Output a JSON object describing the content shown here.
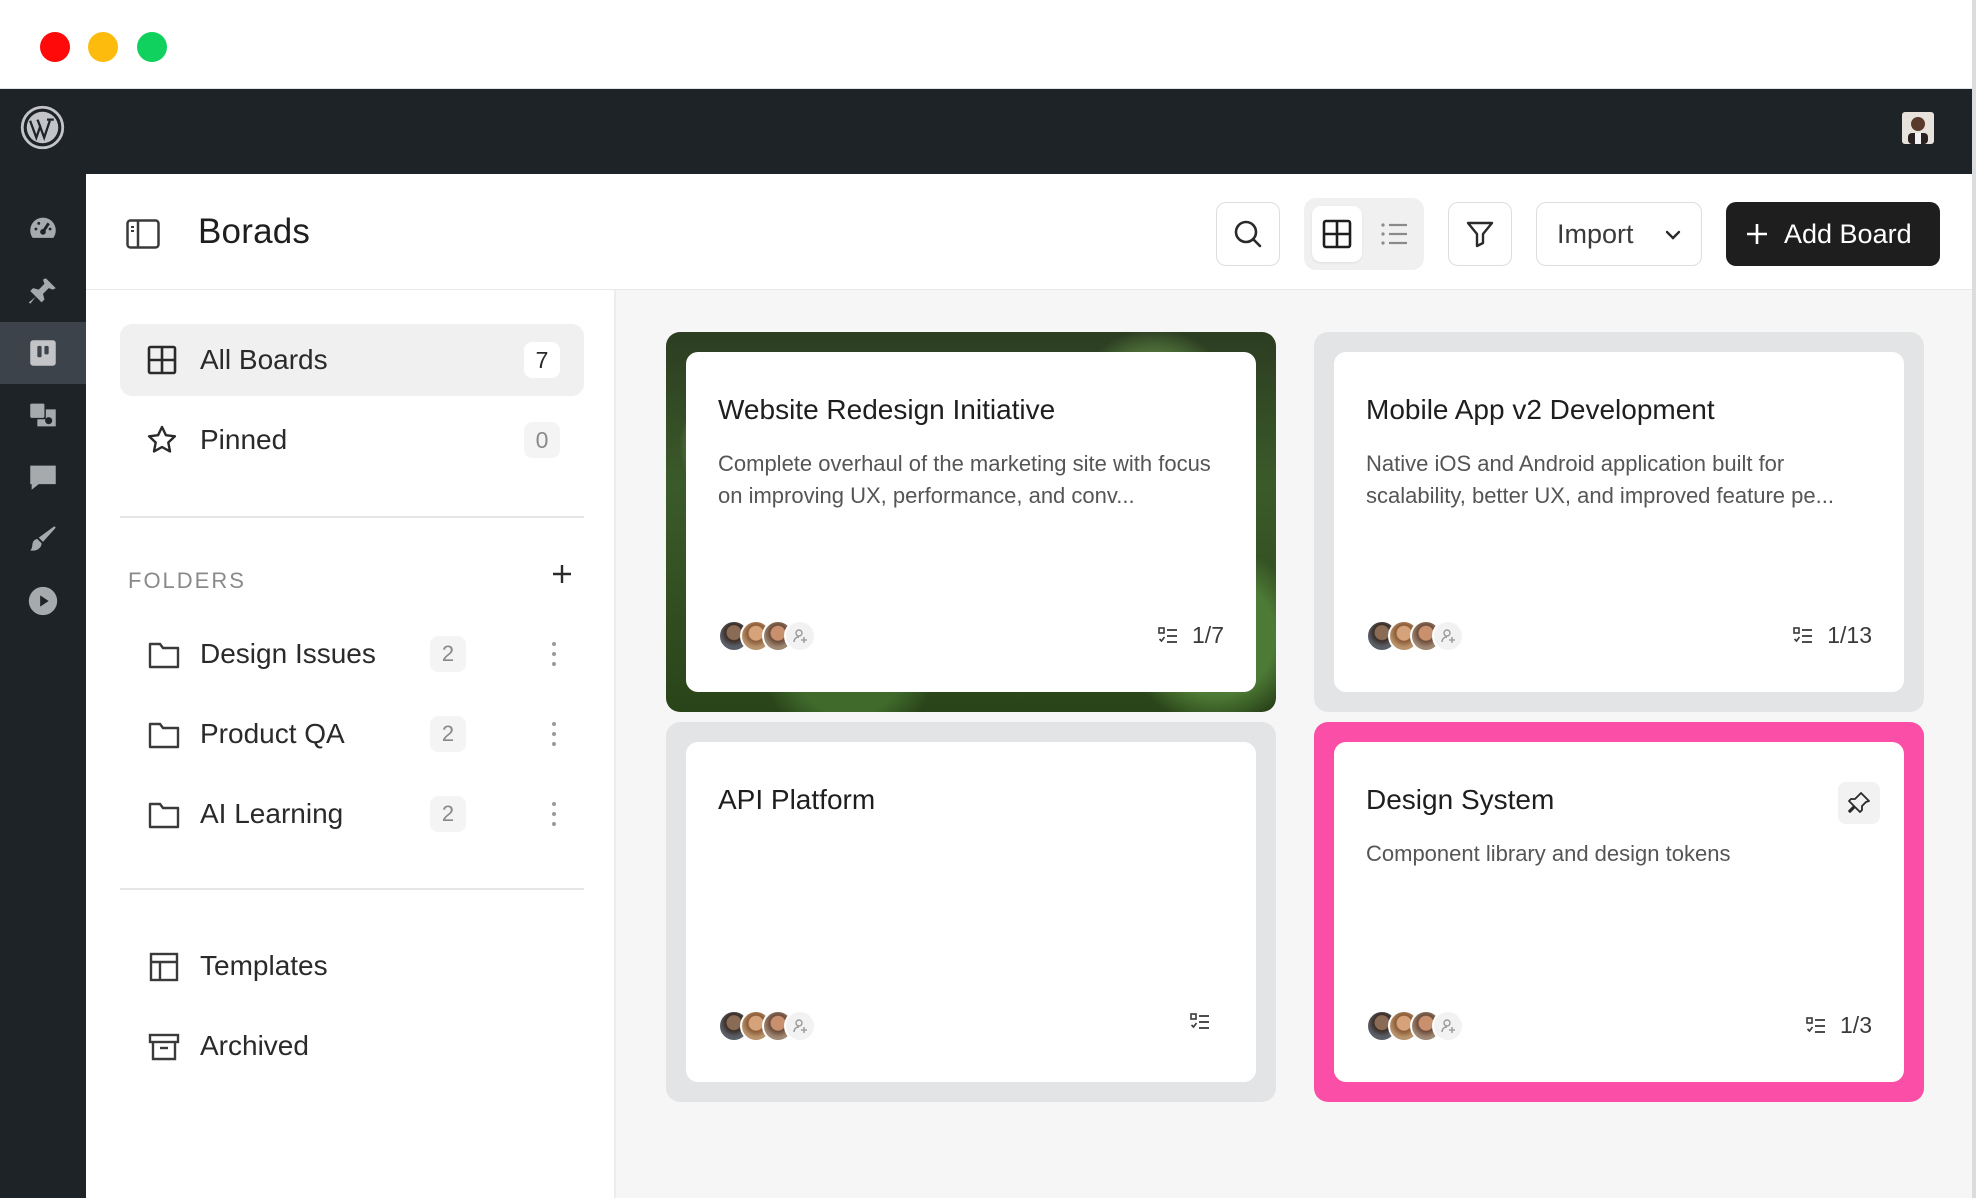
{
  "header": {
    "title": "Borads",
    "import_label": "Import",
    "add_board_label": "Add Board"
  },
  "sidebar": {
    "nav": [
      {
        "label": "All Boards",
        "count": "7",
        "icon": "grid-icon"
      },
      {
        "label": "Pinned",
        "count": "0",
        "icon": "star-icon"
      }
    ],
    "folders_heading": "FOLDERS",
    "folders": [
      {
        "label": "Design Issues",
        "count": "2"
      },
      {
        "label": "Product QA",
        "count": "2"
      },
      {
        "label": "AI Learning",
        "count": "2"
      }
    ],
    "bottom": [
      {
        "label": "Templates",
        "icon": "template-icon"
      },
      {
        "label": "Archived",
        "icon": "archive-icon"
      }
    ]
  },
  "boards": [
    {
      "title": "Website Redesign Initiative",
      "description": "Complete overhaul of the marketing site with focus on improving UX, performance, and conv...",
      "progress": "1/7"
    },
    {
      "title": "Mobile App v2 Development",
      "description": "Native iOS and Android application built for scalability, better UX, and improved feature pe...",
      "progress": "1/13"
    },
    {
      "title": "API Platform",
      "description": "",
      "progress": ""
    },
    {
      "title": "Design System",
      "description": "Component library and design tokens",
      "progress": "1/3"
    }
  ],
  "colors": {
    "admin_bar": "#1d2327",
    "primary_button": "#1e1e1e",
    "pinned_accent": "#fb4ea6"
  }
}
